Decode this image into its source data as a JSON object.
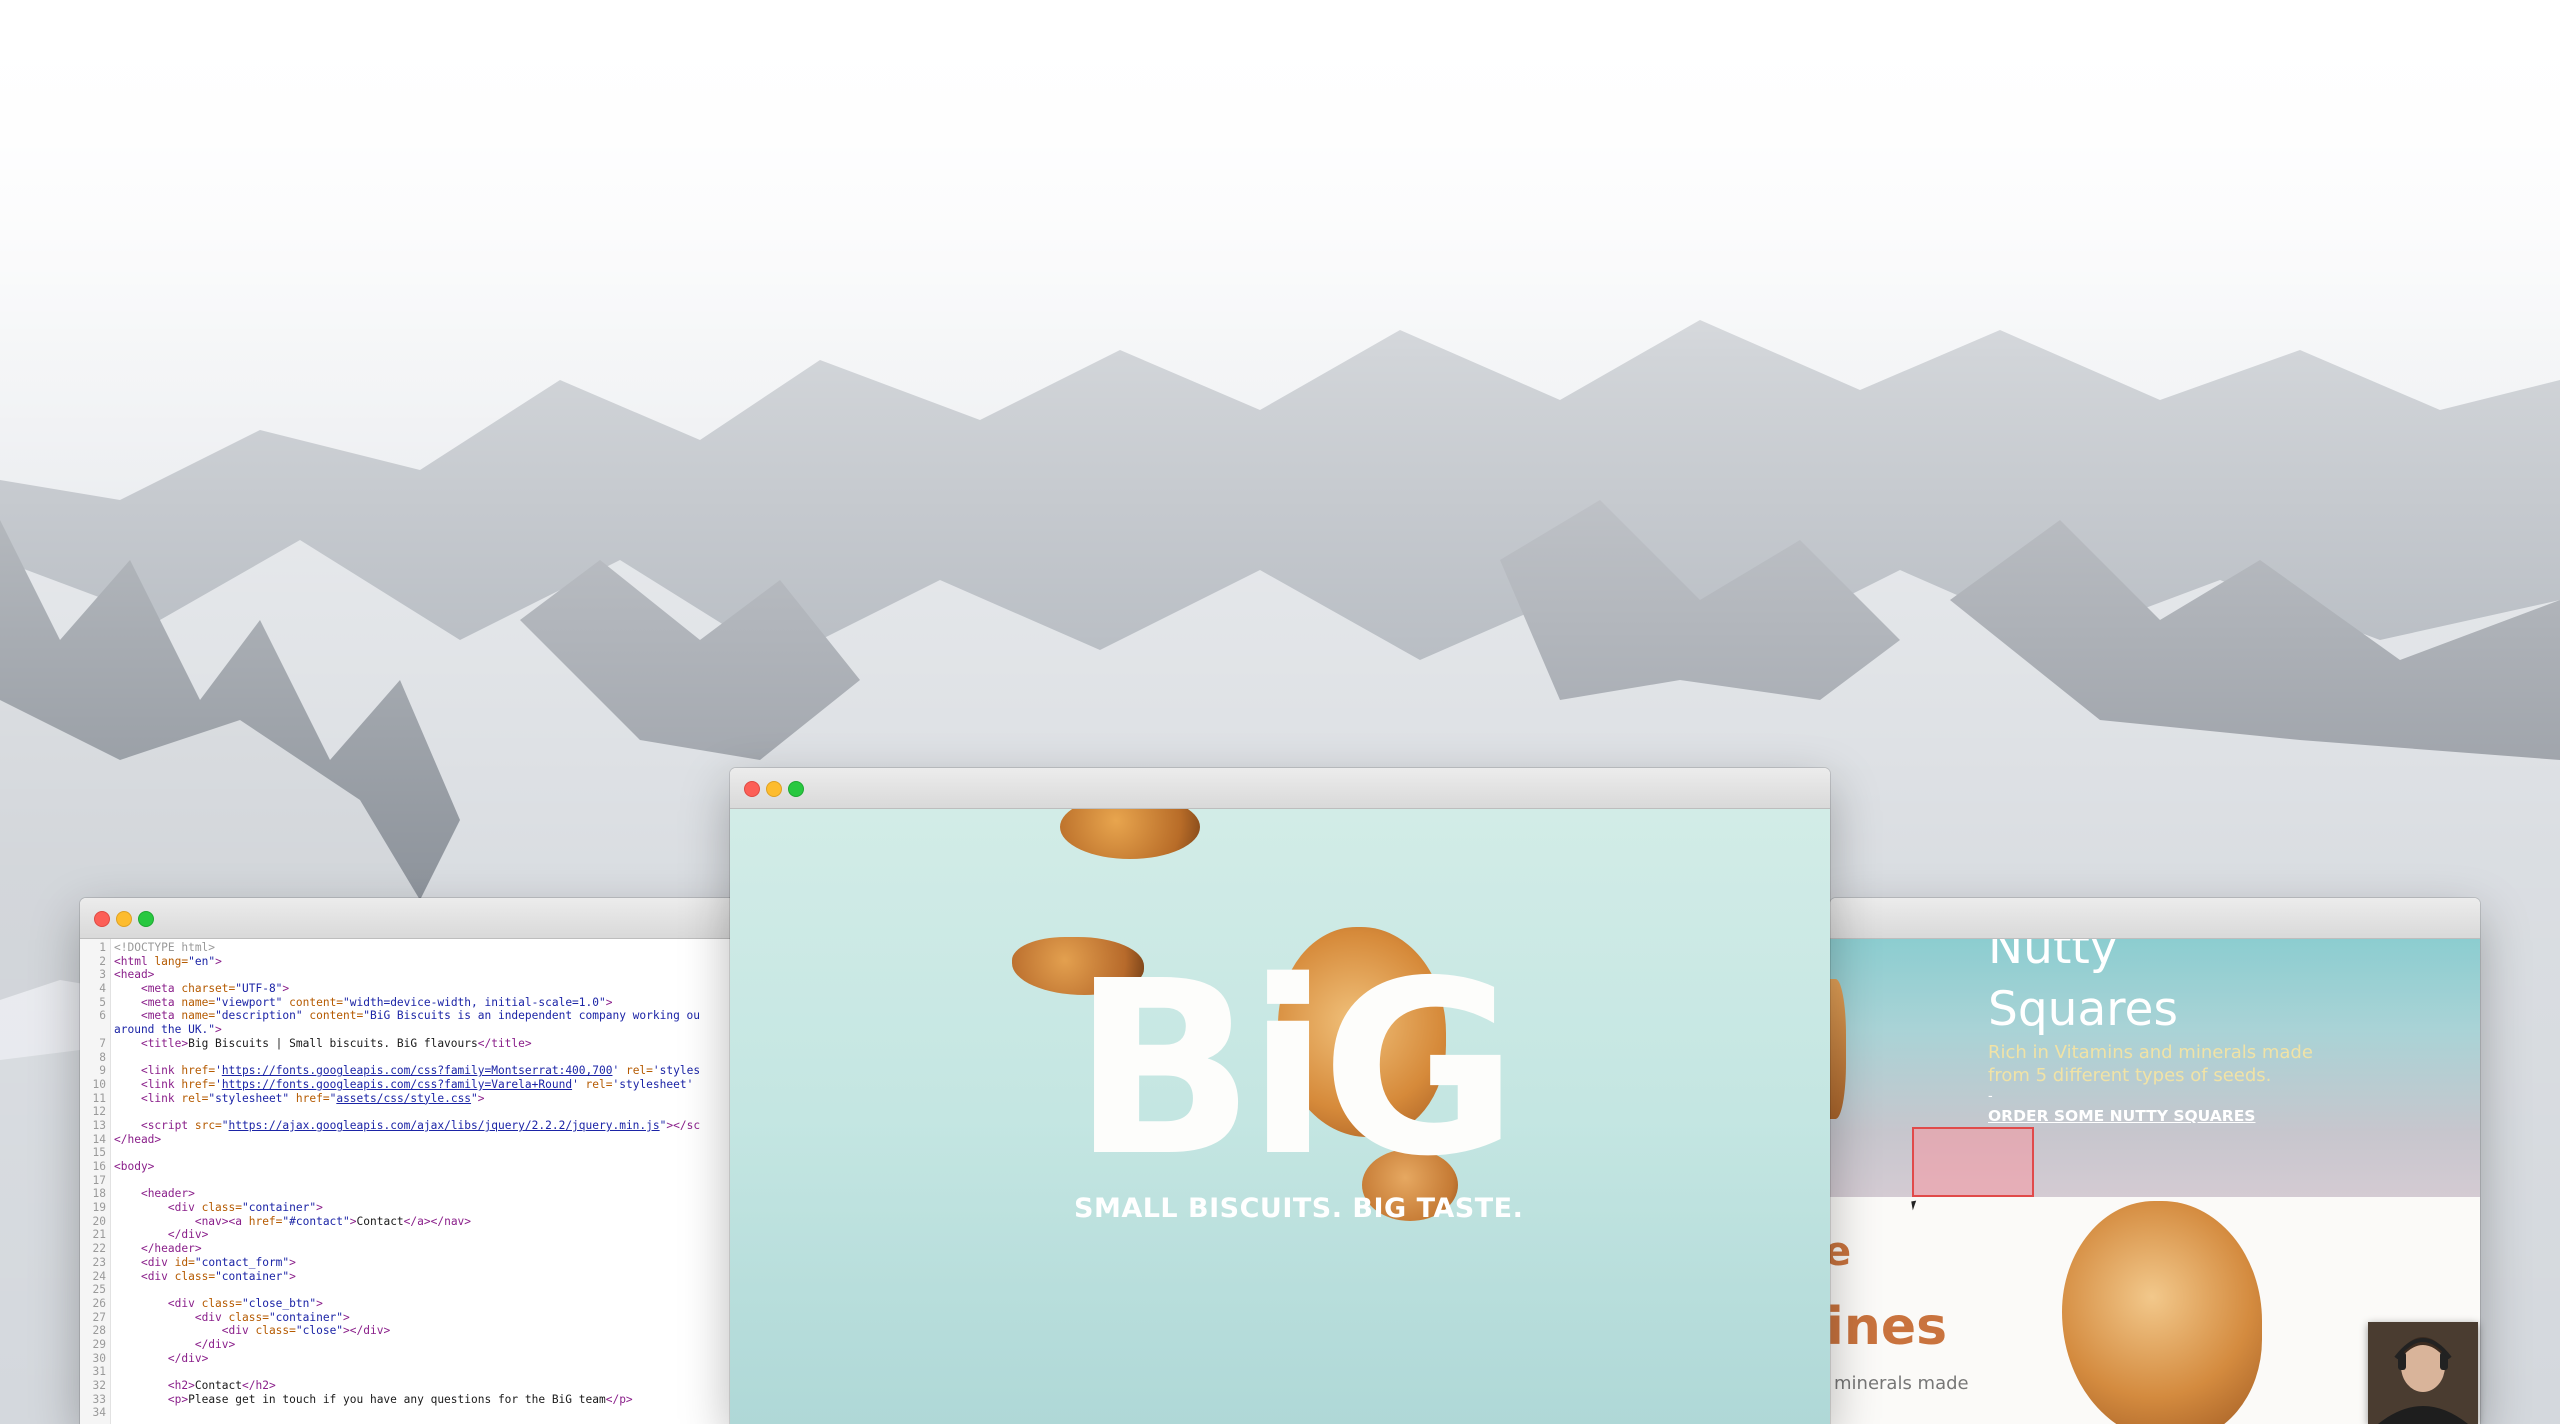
{
  "desktop": {
    "background": "snowy-mountains"
  },
  "editor": {
    "line_numbers": [
      "1",
      "2",
      "3",
      "4",
      "5",
      "6",
      "",
      "7",
      "8",
      "9",
      "10",
      "11",
      "12",
      "13",
      "14",
      "15",
      "16",
      "17",
      "18",
      "19",
      "20",
      "21",
      "22",
      "23",
      "24",
      "25",
      "26",
      "27",
      "28",
      "29",
      "30",
      "31",
      "32",
      "33",
      "34"
    ],
    "lines": [
      {
        "parts": [
          {
            "c": "cm",
            "t": "<!DOCTYPE html>"
          }
        ]
      },
      {
        "parts": [
          {
            "c": "tg",
            "t": "<html "
          },
          {
            "c": "at",
            "t": "lang="
          },
          {
            "c": "st",
            "t": "\"en\""
          },
          {
            "c": "tg",
            "t": ">"
          }
        ]
      },
      {
        "parts": [
          {
            "c": "tg",
            "t": "<head>"
          }
        ]
      },
      {
        "parts": [
          {
            "c": "",
            "t": "    "
          },
          {
            "c": "tg",
            "t": "<meta "
          },
          {
            "c": "at",
            "t": "charset="
          },
          {
            "c": "st",
            "t": "\"UTF-8\""
          },
          {
            "c": "tg",
            "t": ">"
          }
        ]
      },
      {
        "parts": [
          {
            "c": "",
            "t": "    "
          },
          {
            "c": "tg",
            "t": "<meta "
          },
          {
            "c": "at",
            "t": "name="
          },
          {
            "c": "st",
            "t": "\"viewport\" "
          },
          {
            "c": "at",
            "t": "content="
          },
          {
            "c": "st",
            "t": "\"width=device-width, initial-scale=1.0\""
          },
          {
            "c": "tg",
            "t": ">"
          }
        ]
      },
      {
        "parts": [
          {
            "c": "",
            "t": "    "
          },
          {
            "c": "tg",
            "t": "<meta "
          },
          {
            "c": "at",
            "t": "name="
          },
          {
            "c": "st",
            "t": "\"description\" "
          },
          {
            "c": "at",
            "t": "content="
          },
          {
            "c": "st",
            "t": "\"BiG Biscuits is an independent company working ou"
          }
        ]
      },
      {
        "parts": [
          {
            "c": "st",
            "t": "around the UK.\""
          },
          {
            "c": "tg",
            "t": ">"
          }
        ]
      },
      {
        "parts": [
          {
            "c": "",
            "t": "    "
          },
          {
            "c": "tg",
            "t": "<title>"
          },
          {
            "c": "",
            "t": "Big Biscuits | Small biscuits. BiG flavours"
          },
          {
            "c": "tg",
            "t": "</title>"
          }
        ]
      },
      {
        "parts": [
          {
            "c": "",
            "t": ""
          }
        ]
      },
      {
        "parts": [
          {
            "c": "",
            "t": "    "
          },
          {
            "c": "tg",
            "t": "<link "
          },
          {
            "c": "at",
            "t": "href="
          },
          {
            "c": "st",
            "t": "'"
          },
          {
            "c": "ln",
            "t": "https://fonts.googleapis.com/css?family=Montserrat:400,700"
          },
          {
            "c": "st",
            "t": "' "
          },
          {
            "c": "at",
            "t": "rel="
          },
          {
            "c": "st",
            "t": "'styles"
          }
        ]
      },
      {
        "parts": [
          {
            "c": "",
            "t": "    "
          },
          {
            "c": "tg",
            "t": "<link "
          },
          {
            "c": "at",
            "t": "href="
          },
          {
            "c": "st",
            "t": "'"
          },
          {
            "c": "ln",
            "t": "https://fonts.googleapis.com/css?family=Varela+Round"
          },
          {
            "c": "st",
            "t": "' "
          },
          {
            "c": "at",
            "t": "rel="
          },
          {
            "c": "st",
            "t": "'stylesheet'"
          }
        ]
      },
      {
        "parts": [
          {
            "c": "",
            "t": "    "
          },
          {
            "c": "tg",
            "t": "<link "
          },
          {
            "c": "at",
            "t": "rel="
          },
          {
            "c": "st",
            "t": "\"stylesheet\" "
          },
          {
            "c": "at",
            "t": "href="
          },
          {
            "c": "st",
            "t": "\""
          },
          {
            "c": "ln",
            "t": "assets/css/style.css"
          },
          {
            "c": "st",
            "t": "\""
          },
          {
            "c": "tg",
            "t": ">"
          }
        ]
      },
      {
        "parts": [
          {
            "c": "",
            "t": ""
          }
        ]
      },
      {
        "parts": [
          {
            "c": "",
            "t": "    "
          },
          {
            "c": "tg",
            "t": "<script "
          },
          {
            "c": "at",
            "t": "src="
          },
          {
            "c": "st",
            "t": "\""
          },
          {
            "c": "ln",
            "t": "https://ajax.googleapis.com/ajax/libs/jquery/2.2.2/jquery.min.js"
          },
          {
            "c": "st",
            "t": "\""
          },
          {
            "c": "tg",
            "t": "></sc"
          }
        ]
      },
      {
        "parts": [
          {
            "c": "tg",
            "t": "</head>"
          }
        ]
      },
      {
        "parts": [
          {
            "c": "",
            "t": ""
          }
        ]
      },
      {
        "parts": [
          {
            "c": "tg",
            "t": "<body>"
          }
        ]
      },
      {
        "parts": [
          {
            "c": "",
            "t": ""
          }
        ]
      },
      {
        "parts": [
          {
            "c": "",
            "t": "    "
          },
          {
            "c": "tg",
            "t": "<header>"
          }
        ]
      },
      {
        "parts": [
          {
            "c": "",
            "t": "        "
          },
          {
            "c": "tg",
            "t": "<div "
          },
          {
            "c": "at",
            "t": "class="
          },
          {
            "c": "st",
            "t": "\"container\""
          },
          {
            "c": "tg",
            "t": ">"
          }
        ]
      },
      {
        "parts": [
          {
            "c": "",
            "t": "            "
          },
          {
            "c": "tg",
            "t": "<nav><a "
          },
          {
            "c": "at",
            "t": "href="
          },
          {
            "c": "st",
            "t": "\"#contact\""
          },
          {
            "c": "tg",
            "t": ">"
          },
          {
            "c": "",
            "t": "Contact"
          },
          {
            "c": "tg",
            "t": "</a></nav>"
          }
        ]
      },
      {
        "parts": [
          {
            "c": "",
            "t": "        "
          },
          {
            "c": "tg",
            "t": "</div>"
          }
        ]
      },
      {
        "parts": [
          {
            "c": "",
            "t": "    "
          },
          {
            "c": "tg",
            "t": "</header>"
          }
        ]
      },
      {
        "parts": [
          {
            "c": "",
            "t": "    "
          },
          {
            "c": "tg",
            "t": "<div "
          },
          {
            "c": "at",
            "t": "id="
          },
          {
            "c": "st",
            "t": "\"contact_form\""
          },
          {
            "c": "tg",
            "t": ">"
          }
        ]
      },
      {
        "parts": [
          {
            "c": "",
            "t": "    "
          },
          {
            "c": "tg",
            "t": "<div "
          },
          {
            "c": "at",
            "t": "class="
          },
          {
            "c": "st",
            "t": "\"container\""
          },
          {
            "c": "tg",
            "t": ">"
          }
        ]
      },
      {
        "parts": [
          {
            "c": "",
            "t": ""
          }
        ]
      },
      {
        "parts": [
          {
            "c": "",
            "t": "        "
          },
          {
            "c": "tg",
            "t": "<div "
          },
          {
            "c": "at",
            "t": "class="
          },
          {
            "c": "st",
            "t": "\"close_btn\""
          },
          {
            "c": "tg",
            "t": ">"
          }
        ]
      },
      {
        "parts": [
          {
            "c": "",
            "t": "            "
          },
          {
            "c": "tg",
            "t": "<div "
          },
          {
            "c": "at",
            "t": "class="
          },
          {
            "c": "st",
            "t": "\"container\""
          },
          {
            "c": "tg",
            "t": ">"
          }
        ]
      },
      {
        "parts": [
          {
            "c": "",
            "t": "                "
          },
          {
            "c": "tg",
            "t": "<div "
          },
          {
            "c": "at",
            "t": "class="
          },
          {
            "c": "st",
            "t": "\"close\""
          },
          {
            "c": "tg",
            "t": "></div>"
          }
        ]
      },
      {
        "parts": [
          {
            "c": "",
            "t": "            "
          },
          {
            "c": "tg",
            "t": "</div>"
          }
        ]
      },
      {
        "parts": [
          {
            "c": "",
            "t": "        "
          },
          {
            "c": "tg",
            "t": "</div>"
          }
        ]
      },
      {
        "parts": [
          {
            "c": "",
            "t": ""
          }
        ]
      },
      {
        "parts": [
          {
            "c": "",
            "t": "        "
          },
          {
            "c": "tg",
            "t": "<h2>"
          },
          {
            "c": "",
            "t": "Contact"
          },
          {
            "c": "tg",
            "t": "</h2>"
          }
        ]
      },
      {
        "parts": [
          {
            "c": "",
            "t": "        "
          },
          {
            "c": "tg",
            "t": "<p>"
          },
          {
            "c": "",
            "t": "Please get in touch if you have any questions for the BiG team"
          },
          {
            "c": "tg",
            "t": "</p>"
          }
        ]
      },
      {
        "parts": [
          {
            "c": "",
            "t": ""
          }
        ]
      }
    ]
  },
  "browser": {
    "logo": "BiG",
    "tagline": "SMALL BISCUITS. BIG TASTE.",
    "accent": "#c4e6e2"
  },
  "preview": {
    "title_line1": "Nutty",
    "title_line2": "Squares",
    "description": "Rich in Vitamins and minerals made from 5 different types of seeds.",
    "dash": "-",
    "order_link": "ORDER SOME NUTTY SQUARES",
    "partial_heading_top": "e",
    "partial_heading": "ines",
    "partial_text": "minerals made",
    "accent": "#c9733e"
  }
}
